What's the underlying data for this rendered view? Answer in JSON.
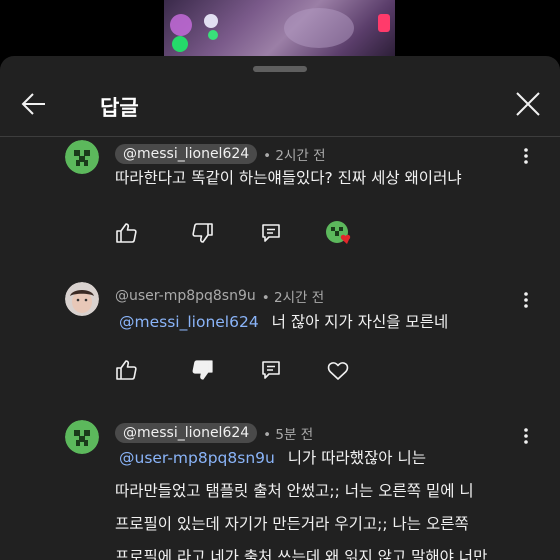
{
  "header": {
    "title": "답글"
  },
  "icons": {
    "back": "arrow-left-icon",
    "close": "close-icon",
    "more": "more-vert-icon"
  },
  "colors": {
    "mention": "#8ab4f8",
    "heart": "#e3262b",
    "sheet": "#212121",
    "chip": "#4a4a4a"
  },
  "comments": [
    {
      "author": "@messi_lionel624",
      "author_style": "chip",
      "time": "• 2시간 전",
      "text": "따라한다고 똑같이 하는얘들있다? 진짜 세상 왜이러냐",
      "disliked": false,
      "creator_hearted": true
    },
    {
      "author": "@user-mp8pq8sn9u",
      "author_style": "plain",
      "time": "• 2시간 전",
      "mention": "@messi_lionel624",
      "text": "너 잖아 지가 자신을 모른네",
      "disliked": true,
      "creator_hearted": false
    },
    {
      "author": "@messi_lionel624",
      "author_style": "chip",
      "time": "• 5분 전",
      "mention": "@user-mp8pq8sn9u",
      "line1": "니가 따라했잖아 니는",
      "line2": "따라만들었고 탬플릿 출처 안썼고;; 너는 오른쪽 밑에 니",
      "line3": "프로필이 있는데 자기가 만든거라 우기고;; 나는 오른쪽",
      "line4": "프로필에 라고 네가 출처 쓰는데 왜 읽지 않고 말해야 너만"
    }
  ]
}
